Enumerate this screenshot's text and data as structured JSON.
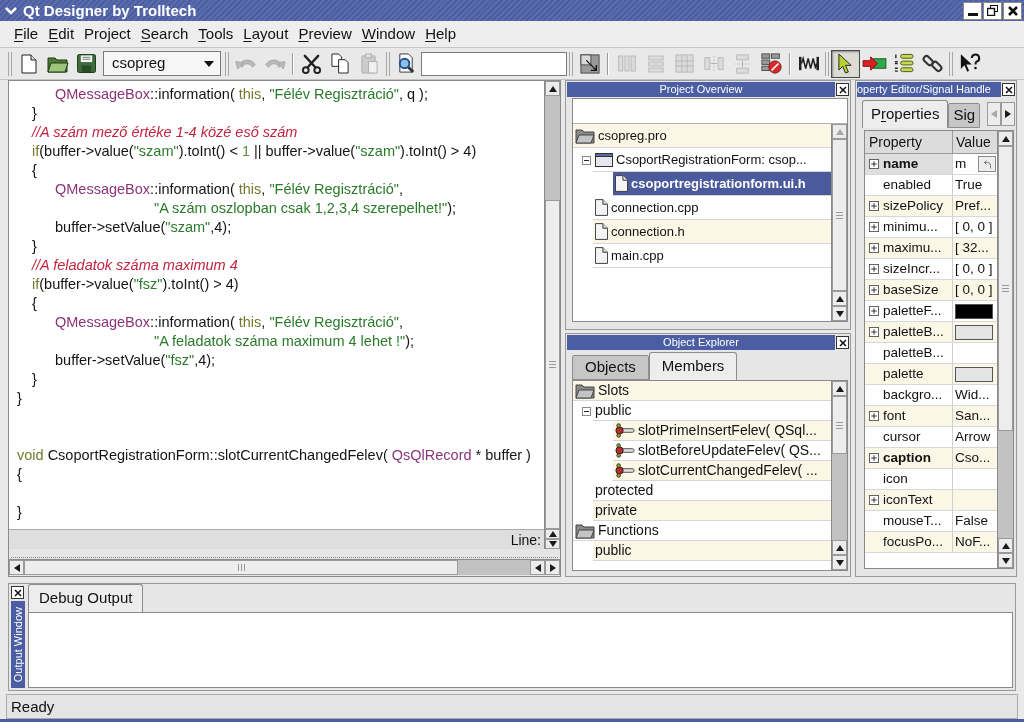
{
  "window": {
    "title": "Qt Designer by Trolltech"
  },
  "menu": [
    {
      "key": "F",
      "post": "ile"
    },
    {
      "key": "E",
      "post": "dit"
    },
    {
      "pre": "Pro",
      "key": "j",
      "post": "ect"
    },
    {
      "key": "S",
      "post": "earch"
    },
    {
      "key": "T",
      "post": "ools"
    },
    {
      "key": "L",
      "post": "ayout"
    },
    {
      "key": "P",
      "post": "review"
    },
    {
      "key": "W",
      "post": "indow"
    },
    {
      "key": "H",
      "post": "elp"
    }
  ],
  "toolbar": {
    "file_buttons": [
      {
        "disabled": false
      },
      {
        "disabled": false
      },
      {
        "disabled": false
      }
    ],
    "project_combo": {
      "value": "csopreg"
    },
    "edit_buttons": [
      {
        "disabled": true
      },
      {
        "disabled": true
      },
      {
        "disabled": false
      },
      {
        "disabled": false
      },
      {
        "disabled": true
      }
    ],
    "search_buttons": [
      {
        "disabled": false
      }
    ],
    "layout_buttons": [
      {
        "disabled": false
      },
      {
        "disabled": true
      },
      {
        "disabled": true
      },
      {
        "disabled": true
      },
      {
        "disabled": true
      },
      {
        "disabled": true
      },
      {
        "disabled": false
      },
      {
        "disabled": false
      }
    ],
    "tool_buttons": [
      {
        "selected": true
      },
      {
        "selected": false
      },
      {
        "selected": false
      },
      {
        "selected": false
      }
    ],
    "help_buttons": [
      {
        "disabled": false
      }
    ]
  },
  "editor": {
    "lines": [
      {
        "kind": "nested",
        "tokens": [
          {
            "kind": "type",
            "text": "QMessageBox"
          },
          {
            "kind": "plain",
            "text": "::information( "
          },
          {
            "kind": "keyword",
            "text": "this"
          },
          {
            "kind": "plain",
            "text": ", "
          },
          {
            "kind": "string",
            "text": "\"Félév Regisztráció\""
          },
          {
            "kind": "plain",
            "text": ", q );"
          }
        ]
      },
      {
        "kind": "indented",
        "tokens": [
          {
            "kind": "plain",
            "text": "}"
          }
        ]
      },
      {
        "kind": "indented",
        "tokens": [
          {
            "kind": "comment",
            "text": "//A szám mező értéke 1-4 közé eső szám"
          }
        ]
      },
      {
        "kind": "indented",
        "tokens": [
          {
            "kind": "keyword",
            "text": "if"
          },
          {
            "kind": "plain",
            "text": "(buffer->value("
          },
          {
            "kind": "string",
            "text": "\"szam\""
          },
          {
            "kind": "plain",
            "text": ").toInt() < "
          },
          {
            "kind": "number",
            "text": "1"
          },
          {
            "kind": "plain",
            "text": " || buffer->value("
          },
          {
            "kind": "string",
            "text": "\"szam\""
          },
          {
            "kind": "plain",
            "text": ").toInt() > 4)"
          }
        ]
      },
      {
        "kind": "indented",
        "tokens": [
          {
            "kind": "plain",
            "text": "{"
          }
        ]
      },
      {
        "kind": "nested",
        "tokens": [
          {
            "kind": "type",
            "text": "QMessageBox"
          },
          {
            "kind": "plain",
            "text": "::information( "
          },
          {
            "kind": "keyword",
            "text": "this"
          },
          {
            "kind": "plain",
            "text": ", "
          },
          {
            "kind": "string",
            "text": "\"Félév Regisztráció\""
          },
          {
            "kind": "plain",
            "text": ","
          }
        ]
      },
      {
        "kind": "continuation",
        "tokens": [
          {
            "kind": "string",
            "text": "\"A szám oszlopban csak 1,2,3,4 szerepelhet!\""
          },
          {
            "kind": "plain",
            "text": ");"
          }
        ]
      },
      {
        "kind": "nested",
        "tokens": [
          {
            "kind": "plain",
            "text": "buffer->setValue("
          },
          {
            "kind": "string",
            "text": "\"szam\""
          },
          {
            "kind": "plain",
            "text": ",4);"
          }
        ]
      },
      {
        "kind": "indented",
        "tokens": [
          {
            "kind": "plain",
            "text": "}"
          }
        ]
      },
      {
        "kind": "indented",
        "tokens": [
          {
            "kind": "comment",
            "text": "//A feladatok száma maximum 4"
          }
        ]
      },
      {
        "kind": "indented",
        "tokens": [
          {
            "kind": "keyword",
            "text": "if"
          },
          {
            "kind": "plain",
            "text": "(buffer->value("
          },
          {
            "kind": "string",
            "text": "\"fsz\""
          },
          {
            "kind": "plain",
            "text": ").toInt() > 4)"
          }
        ]
      },
      {
        "kind": "indented",
        "tokens": [
          {
            "kind": "plain",
            "text": "{"
          }
        ]
      },
      {
        "kind": "nested",
        "tokens": [
          {
            "kind": "type",
            "text": "QMessageBox"
          },
          {
            "kind": "plain",
            "text": "::information( "
          },
          {
            "kind": "keyword",
            "text": "this"
          },
          {
            "kind": "plain",
            "text": ", "
          },
          {
            "kind": "string",
            "text": "\"Félév Regisztráció\""
          },
          {
            "kind": "plain",
            "text": ","
          }
        ]
      },
      {
        "kind": "continuation",
        "tokens": [
          {
            "kind": "string",
            "text": "\"A feladatok száma maximum 4 lehet !\""
          },
          {
            "kind": "plain",
            "text": ");"
          }
        ]
      },
      {
        "kind": "nested",
        "tokens": [
          {
            "kind": "plain",
            "text": "buffer->setValue("
          },
          {
            "kind": "string",
            "text": "\"fsz\""
          },
          {
            "kind": "plain",
            "text": ",4);"
          }
        ]
      },
      {
        "kind": "indented",
        "tokens": [
          {
            "kind": "plain",
            "text": "}"
          }
        ]
      },
      {
        "kind": "flush",
        "tokens": [
          {
            "kind": "plain",
            "text": "}"
          }
        ]
      },
      {
        "kind": "blank"
      },
      {
        "kind": "blank"
      },
      {
        "kind": "flush",
        "tokens": [
          {
            "kind": "keyword",
            "text": "void"
          },
          {
            "kind": "plain",
            "text": " CsoportRegistrationForm::slotCurrentChangedFelev( "
          },
          {
            "kind": "type",
            "text": "QsQlRecord"
          },
          {
            "kind": "plain",
            "text": " * buffer )"
          }
        ]
      },
      {
        "kind": "flush",
        "tokens": [
          {
            "kind": "plain",
            "text": "{"
          }
        ]
      },
      {
        "kind": "blank"
      },
      {
        "kind": "flush",
        "tokens": [
          {
            "kind": "plain",
            "text": "}"
          }
        ]
      }
    ],
    "line_label": "Line:"
  },
  "project_overview": {
    "title": "Project Overview",
    "tree": [
      {
        "label": "csopreg.pro",
        "kind": "project",
        "selected": false,
        "children": [
          {
            "label": "CsoportRegistrationForm: csop...",
            "kind": "form",
            "expanded": true,
            "selected": false,
            "children": [
              {
                "label": "csoportregistrationform.ui.h",
                "kind": "file",
                "selected": true
              }
            ]
          },
          {
            "label": "connection.cpp",
            "kind": "file",
            "selected": false
          },
          {
            "label": "connection.h",
            "kind": "file",
            "selected": false
          },
          {
            "label": "main.cpp",
            "kind": "file",
            "selected": false
          }
        ]
      }
    ]
  },
  "object_explorer": {
    "title": "Object Explorer",
    "tabs": [
      {
        "label": "Objects",
        "selected": false
      },
      {
        "label": "Members",
        "selected": true
      }
    ],
    "tree": [
      {
        "label": "Slots",
        "kind": "folder",
        "children": [
          {
            "label": "public",
            "expanded": true,
            "children": [
              {
                "label": "slotPrimeInsertFelev( QSql...",
                "kind": "slot"
              },
              {
                "label": "slotBeforeUpdateFelev( QS...",
                "kind": "slot"
              },
              {
                "label": "slotCurrentChangedFelev( ...",
                "kind": "slot"
              }
            ]
          },
          {
            "label": "protected"
          },
          {
            "label": "private"
          }
        ]
      },
      {
        "label": "Functions",
        "kind": "folder",
        "children": [
          {
            "label": "public"
          }
        ]
      }
    ]
  },
  "property_editor": {
    "title": "operty Editor/Signal Handle",
    "tabs": [
      {
        "pre": "P",
        "key": "r",
        "post": "operties",
        "selected": true
      },
      {
        "label": "Sig",
        "selected": false
      }
    ],
    "columns": [
      "Property",
      "Value"
    ],
    "rows": [
      {
        "name": "name",
        "bold": true,
        "expandable": true,
        "selected": true,
        "kind": "editor",
        "value": "m"
      },
      {
        "name": "enabled",
        "bold": false,
        "expandable": false,
        "selected": false,
        "kind": "text",
        "value": "True"
      },
      {
        "name": "sizePolicy",
        "bold": false,
        "expandable": true,
        "selected": false,
        "kind": "text",
        "value": "Pref..."
      },
      {
        "name": "minimu...",
        "bold": false,
        "expandable": true,
        "selected": false,
        "kind": "text",
        "value": "[ 0, 0 ]"
      },
      {
        "name": "maximu...",
        "bold": false,
        "expandable": true,
        "selected": false,
        "kind": "text",
        "value": "[ 32..."
      },
      {
        "name": "sizeIncr...",
        "bold": false,
        "expandable": true,
        "selected": false,
        "kind": "text",
        "value": "[ 0, 0 ]"
      },
      {
        "name": "baseSize",
        "bold": false,
        "expandable": true,
        "selected": false,
        "kind": "text",
        "value": "[ 0, 0 ]"
      },
      {
        "name": "paletteF...",
        "bold": false,
        "expandable": true,
        "selected": false,
        "kind": "swatch",
        "color": "#000000"
      },
      {
        "name": "paletteB...",
        "bold": false,
        "expandable": true,
        "selected": false,
        "kind": "swatch",
        "color": "#e4e4e4"
      },
      {
        "name": "paletteB...",
        "bold": false,
        "expandable": false,
        "selected": false,
        "kind": "empty"
      },
      {
        "name": "palette",
        "bold": false,
        "expandable": false,
        "selected": false,
        "kind": "swatch",
        "color": "#e4e4e4"
      },
      {
        "name": "backgro...",
        "bold": false,
        "expandable": false,
        "selected": false,
        "kind": "text",
        "value": "Wid..."
      },
      {
        "name": "font",
        "bold": false,
        "expandable": true,
        "selected": false,
        "kind": "text",
        "value": "San..."
      },
      {
        "name": "cursor",
        "bold": false,
        "expandable": false,
        "selected": false,
        "kind": "text",
        "value": "Arrow"
      },
      {
        "name": "caption",
        "bold": true,
        "expandable": true,
        "selected": false,
        "kind": "text",
        "value": "Cso..."
      },
      {
        "name": "icon",
        "bold": false,
        "expandable": false,
        "selected": false,
        "kind": "empty"
      },
      {
        "name": "iconText",
        "bold": false,
        "expandable": true,
        "selected": false,
        "kind": "empty"
      },
      {
        "name": "mouseT...",
        "bold": false,
        "expandable": false,
        "selected": false,
        "kind": "text",
        "value": "False"
      },
      {
        "name": "focusPo...",
        "bold": false,
        "expandable": false,
        "selected": false,
        "kind": "text",
        "value": "NoF..."
      }
    ]
  },
  "output_window": {
    "title": "Output Window",
    "tabs": [
      {
        "label": "Debug Output",
        "selected": true
      }
    ]
  },
  "status_bar": {
    "message": "Ready"
  }
}
